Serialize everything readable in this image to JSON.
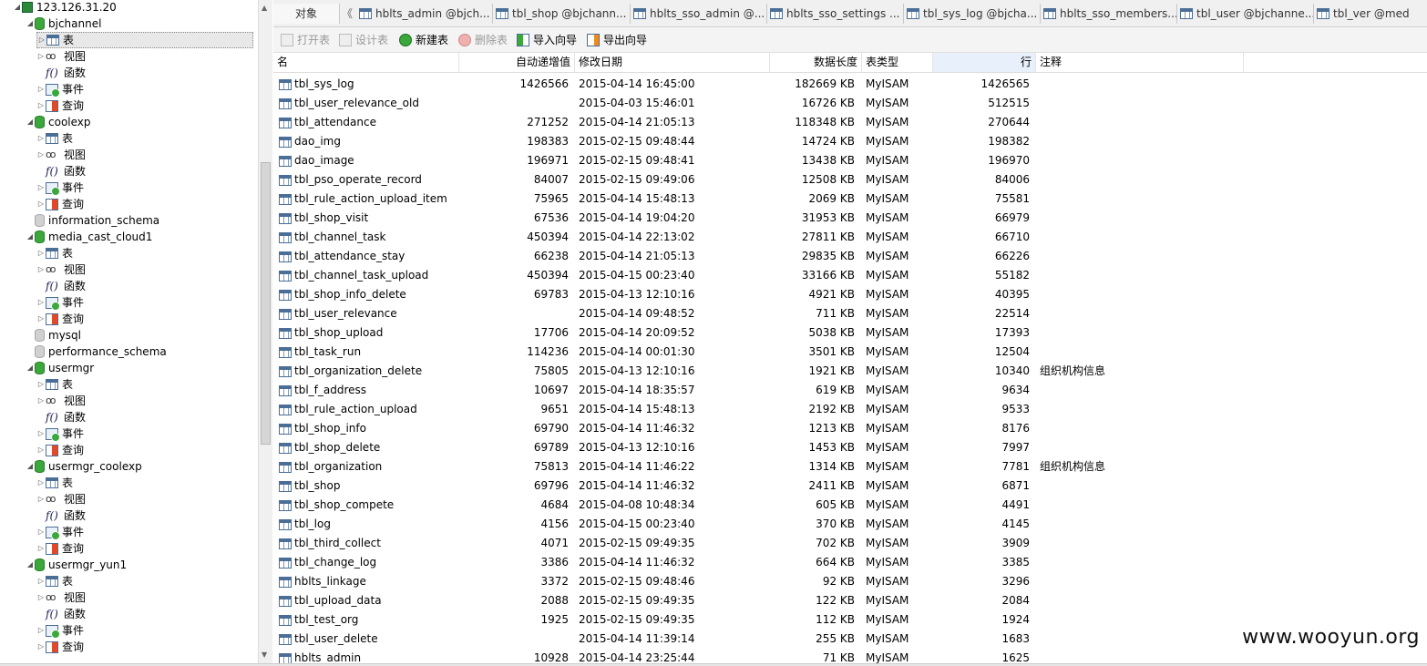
{
  "sidebar": {
    "server": "123.126.31.20",
    "databases": [
      {
        "name": "bjchannel",
        "expanded": true,
        "children": [
          "表",
          "视图",
          "函数",
          "事件",
          "查询"
        ]
      },
      {
        "name": "coolexp",
        "expanded": true,
        "children": [
          "表",
          "视图",
          "函数",
          "事件",
          "查询"
        ]
      },
      {
        "name": "information_schema",
        "expanded": false,
        "children": []
      },
      {
        "name": "media_cast_cloud1",
        "expanded": true,
        "children": [
          "表",
          "视图",
          "函数",
          "事件",
          "查询"
        ]
      },
      {
        "name": "mysql",
        "expanded": false,
        "children": []
      },
      {
        "name": "performance_schema",
        "expanded": false,
        "children": []
      },
      {
        "name": "usermgr",
        "expanded": true,
        "children": [
          "表",
          "视图",
          "函数",
          "事件",
          "查询"
        ]
      },
      {
        "name": "usermgr_coolexp",
        "expanded": true,
        "children": [
          "表",
          "视图",
          "函数",
          "事件",
          "查询"
        ]
      },
      {
        "name": "usermgr_yun1",
        "expanded": true,
        "children": [
          "表",
          "视图",
          "函数",
          "事件",
          "查询"
        ]
      }
    ]
  },
  "tabs": {
    "objects_label": "对象",
    "scroll_left": "《",
    "items": [
      "hblts_admin @bjch...",
      "tbl_shop @bjchann...",
      "hblts_sso_admin @...",
      "hblts_sso_settings ...",
      "tbl_sys_log @bjcha...",
      "hblts_sso_members...",
      "tbl_user @bjchanne...",
      "tbl_ver @med"
    ]
  },
  "toolbar": {
    "open_table": "打开表",
    "design_table": "设计表",
    "new_table": "新建表",
    "delete_table": "删除表",
    "import_wizard": "导入向导",
    "export_wizard": "导出向导"
  },
  "grid": {
    "columns": [
      "名",
      "自动递增值",
      "修改日期",
      "数据长度",
      "表类型",
      "行",
      "注释"
    ],
    "rows": [
      [
        "tbl_sys_log",
        "1426566",
        "2015-04-14 16:45:00",
        "182669 KB",
        "MyISAM",
        "1426565",
        ""
      ],
      [
        "tbl_user_relevance_old",
        "",
        "2015-04-03 15:46:01",
        "16726 KB",
        "MyISAM",
        "512515",
        ""
      ],
      [
        "tbl_attendance",
        "271252",
        "2015-04-14 21:05:13",
        "118348 KB",
        "MyISAM",
        "270644",
        ""
      ],
      [
        "dao_img",
        "198383",
        "2015-02-15 09:48:44",
        "14724 KB",
        "MyISAM",
        "198382",
        ""
      ],
      [
        "dao_image",
        "196971",
        "2015-02-15 09:48:41",
        "13438 KB",
        "MyISAM",
        "196970",
        ""
      ],
      [
        "tbl_pso_operate_record",
        "84007",
        "2015-02-15 09:49:06",
        "12508 KB",
        "MyISAM",
        "84006",
        ""
      ],
      [
        "tbl_rule_action_upload_item",
        "75965",
        "2015-04-14 15:48:13",
        "2069 KB",
        "MyISAM",
        "75581",
        ""
      ],
      [
        "tbl_shop_visit",
        "67536",
        "2015-04-14 19:04:20",
        "31953 KB",
        "MyISAM",
        "66979",
        ""
      ],
      [
        "tbl_channel_task",
        "450394",
        "2015-04-14 22:13:02",
        "27811 KB",
        "MyISAM",
        "66710",
        ""
      ],
      [
        "tbl_attendance_stay",
        "66238",
        "2015-04-14 21:05:13",
        "29835 KB",
        "MyISAM",
        "66226",
        ""
      ],
      [
        "tbl_channel_task_upload",
        "450394",
        "2015-04-15 00:23:40",
        "33166 KB",
        "MyISAM",
        "55182",
        ""
      ],
      [
        "tbl_shop_info_delete",
        "69783",
        "2015-04-13 12:10:16",
        "4921 KB",
        "MyISAM",
        "40395",
        ""
      ],
      [
        "tbl_user_relevance",
        "",
        "2015-04-14 09:48:52",
        "711 KB",
        "MyISAM",
        "22514",
        ""
      ],
      [
        "tbl_shop_upload",
        "17706",
        "2015-04-14 20:09:52",
        "5038 KB",
        "MyISAM",
        "17393",
        ""
      ],
      [
        "tbl_task_run",
        "114236",
        "2015-04-14 00:01:30",
        "3501 KB",
        "MyISAM",
        "12504",
        ""
      ],
      [
        "tbl_organization_delete",
        "75805",
        "2015-04-13 12:10:16",
        "1921 KB",
        "MyISAM",
        "10340",
        "组织机构信息"
      ],
      [
        "tbl_f_address",
        "10697",
        "2015-04-14 18:35:57",
        "619 KB",
        "MyISAM",
        "9634",
        ""
      ],
      [
        "tbl_rule_action_upload",
        "9651",
        "2015-04-14 15:48:13",
        "2192 KB",
        "MyISAM",
        "9533",
        ""
      ],
      [
        "tbl_shop_info",
        "69790",
        "2015-04-14 11:46:32",
        "1213 KB",
        "MyISAM",
        "8176",
        ""
      ],
      [
        "tbl_shop_delete",
        "69789",
        "2015-04-13 12:10:16",
        "1453 KB",
        "MyISAM",
        "7997",
        ""
      ],
      [
        "tbl_organization",
        "75813",
        "2015-04-14 11:46:22",
        "1314 KB",
        "MyISAM",
        "7781",
        "组织机构信息"
      ],
      [
        "tbl_shop",
        "69796",
        "2015-04-14 11:46:32",
        "2411 KB",
        "MyISAM",
        "6871",
        ""
      ],
      [
        "tbl_shop_compete",
        "4684",
        "2015-04-08 10:48:34",
        "605 KB",
        "MyISAM",
        "4491",
        ""
      ],
      [
        "tbl_log",
        "4156",
        "2015-04-15 00:23:40",
        "370 KB",
        "MyISAM",
        "4145",
        ""
      ],
      [
        "tbl_third_collect",
        "4071",
        "2015-02-15 09:49:35",
        "702 KB",
        "MyISAM",
        "3909",
        ""
      ],
      [
        "tbl_change_log",
        "3386",
        "2015-04-14 11:46:32",
        "664 KB",
        "MyISAM",
        "3385",
        ""
      ],
      [
        "hblts_linkage",
        "3372",
        "2015-02-15 09:48:46",
        "92 KB",
        "MyISAM",
        "3296",
        ""
      ],
      [
        "tbl_upload_data",
        "2088",
        "2015-02-15 09:49:35",
        "122 KB",
        "MyISAM",
        "2084",
        ""
      ],
      [
        "tbl_test_org",
        "1925",
        "2015-02-15 09:49:35",
        "112 KB",
        "MyISAM",
        "1924",
        ""
      ],
      [
        "tbl_user_delete",
        "",
        "2015-04-14 11:39:14",
        "255 KB",
        "MyISAM",
        "1683",
        ""
      ],
      [
        "hblts_admin",
        "10928",
        "2015-04-14 23:25:44",
        "71 KB",
        "MyISAM",
        "1625",
        ""
      ]
    ]
  },
  "watermark": "www.wooyun.org"
}
